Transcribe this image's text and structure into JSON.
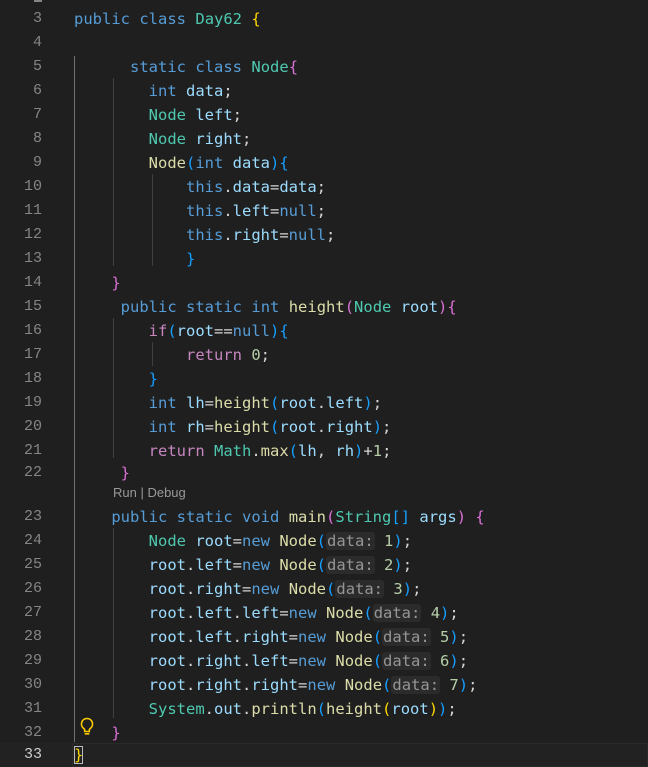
{
  "editor": {
    "lines": [
      {
        "num": "3",
        "tokens": [
          [
            "kw",
            "public"
          ],
          [
            "p",
            " "
          ],
          [
            "kw",
            "class"
          ],
          [
            "p",
            " "
          ],
          [
            "ty",
            "Day62"
          ],
          [
            "p",
            " "
          ],
          [
            "b1",
            "{"
          ]
        ]
      },
      {
        "num": "4",
        "tokens": []
      },
      {
        "num": "5",
        "tokens": [
          [
            "p",
            "      "
          ],
          [
            "kw",
            "static"
          ],
          [
            "p",
            " "
          ],
          [
            "kw",
            "class"
          ],
          [
            "p",
            " "
          ],
          [
            "ty",
            "Node"
          ],
          [
            "b2",
            "{"
          ]
        ]
      },
      {
        "num": "6",
        "tokens": [
          [
            "p",
            "        "
          ],
          [
            "kw",
            "int"
          ],
          [
            "p",
            " "
          ],
          [
            "va",
            "data"
          ],
          [
            "p",
            ";"
          ]
        ]
      },
      {
        "num": "7",
        "tokens": [
          [
            "p",
            "        "
          ],
          [
            "ty",
            "Node"
          ],
          [
            "p",
            " "
          ],
          [
            "va",
            "left"
          ],
          [
            "p",
            ";"
          ]
        ]
      },
      {
        "num": "8",
        "tokens": [
          [
            "p",
            "        "
          ],
          [
            "ty",
            "Node"
          ],
          [
            "p",
            " "
          ],
          [
            "va",
            "right"
          ],
          [
            "p",
            ";"
          ]
        ]
      },
      {
        "num": "9",
        "tokens": [
          [
            "p",
            "        "
          ],
          [
            "fn",
            "Node"
          ],
          [
            "b3",
            "("
          ],
          [
            "kw",
            "int"
          ],
          [
            "p",
            " "
          ],
          [
            "va",
            "data"
          ],
          [
            "b3",
            ")"
          ],
          [
            "b3",
            "{"
          ]
        ]
      },
      {
        "num": "10",
        "tokens": [
          [
            "p",
            "            "
          ],
          [
            "kw",
            "this"
          ],
          [
            "p",
            "."
          ],
          [
            "va",
            "data"
          ],
          [
            "p",
            "="
          ],
          [
            "va",
            "data"
          ],
          [
            "p",
            ";"
          ]
        ]
      },
      {
        "num": "11",
        "tokens": [
          [
            "p",
            "            "
          ],
          [
            "kw",
            "this"
          ],
          [
            "p",
            "."
          ],
          [
            "va",
            "left"
          ],
          [
            "p",
            "="
          ],
          [
            "kw",
            "null"
          ],
          [
            "p",
            ";"
          ]
        ]
      },
      {
        "num": "12",
        "tokens": [
          [
            "p",
            "            "
          ],
          [
            "kw",
            "this"
          ],
          [
            "p",
            "."
          ],
          [
            "va",
            "right"
          ],
          [
            "p",
            "="
          ],
          [
            "kw",
            "null"
          ],
          [
            "p",
            ";"
          ]
        ]
      },
      {
        "num": "13",
        "tokens": [
          [
            "p",
            "            "
          ],
          [
            "b3",
            "}"
          ]
        ]
      },
      {
        "num": "14",
        "tokens": [
          [
            "p",
            "    "
          ],
          [
            "b2",
            "}"
          ]
        ]
      },
      {
        "num": "15",
        "tokens": [
          [
            "p",
            "     "
          ],
          [
            "kw",
            "public"
          ],
          [
            "p",
            " "
          ],
          [
            "kw",
            "static"
          ],
          [
            "p",
            " "
          ],
          [
            "kw",
            "int"
          ],
          [
            "p",
            " "
          ],
          [
            "fn",
            "height"
          ],
          [
            "b2",
            "("
          ],
          [
            "ty",
            "Node"
          ],
          [
            "p",
            " "
          ],
          [
            "va",
            "root"
          ],
          [
            "b2",
            ")"
          ],
          [
            "b2",
            "{"
          ]
        ]
      },
      {
        "num": "16",
        "tokens": [
          [
            "p",
            "        "
          ],
          [
            "ctl",
            "if"
          ],
          [
            "b3",
            "("
          ],
          [
            "va",
            "root"
          ],
          [
            "p",
            "=="
          ],
          [
            "kw",
            "null"
          ],
          [
            "b3",
            ")"
          ],
          [
            "b3",
            "{"
          ]
        ]
      },
      {
        "num": "17",
        "tokens": [
          [
            "p",
            "            "
          ],
          [
            "ctl",
            "return"
          ],
          [
            "p",
            " "
          ],
          [
            "nu",
            "0"
          ],
          [
            "p",
            ";"
          ]
        ]
      },
      {
        "num": "18",
        "tokens": [
          [
            "p",
            "        "
          ],
          [
            "b3",
            "}"
          ]
        ]
      },
      {
        "num": "19",
        "tokens": [
          [
            "p",
            "        "
          ],
          [
            "kw",
            "int"
          ],
          [
            "p",
            " "
          ],
          [
            "va",
            "lh"
          ],
          [
            "p",
            "="
          ],
          [
            "fn",
            "height"
          ],
          [
            "b3",
            "("
          ],
          [
            "va",
            "root"
          ],
          [
            "p",
            "."
          ],
          [
            "va",
            "left"
          ],
          [
            "b3",
            ")"
          ],
          [
            "p",
            ";"
          ]
        ]
      },
      {
        "num": "20",
        "tokens": [
          [
            "p",
            "        "
          ],
          [
            "kw",
            "int"
          ],
          [
            "p",
            " "
          ],
          [
            "va",
            "rh"
          ],
          [
            "p",
            "="
          ],
          [
            "fn",
            "height"
          ],
          [
            "b3",
            "("
          ],
          [
            "va",
            "root"
          ],
          [
            "p",
            "."
          ],
          [
            "va",
            "right"
          ],
          [
            "b3",
            ")"
          ],
          [
            "p",
            ";"
          ]
        ]
      },
      {
        "num": "21",
        "tokens": [
          [
            "p",
            "        "
          ],
          [
            "ctl",
            "return"
          ],
          [
            "p",
            " "
          ],
          [
            "ty",
            "Math"
          ],
          [
            "p",
            "."
          ],
          [
            "fn",
            "max"
          ],
          [
            "b3",
            "("
          ],
          [
            "va",
            "lh"
          ],
          [
            "p",
            ", "
          ],
          [
            "va",
            "rh"
          ],
          [
            "b3",
            ")"
          ],
          [
            "p",
            "+"
          ],
          [
            "nu",
            "1"
          ],
          [
            "p",
            ";"
          ]
        ]
      },
      {
        "num": "22",
        "tokens": [
          [
            "p",
            "     "
          ],
          [
            "b2",
            "}"
          ]
        ]
      },
      {
        "num": "23",
        "tokens": [
          [
            "p",
            "    "
          ],
          [
            "kw",
            "public"
          ],
          [
            "p",
            " "
          ],
          [
            "kw",
            "static"
          ],
          [
            "p",
            " "
          ],
          [
            "kw",
            "void"
          ],
          [
            "p",
            " "
          ],
          [
            "fn",
            "main"
          ],
          [
            "b2",
            "("
          ],
          [
            "ty",
            "String"
          ],
          [
            "b3",
            "[]"
          ],
          [
            "p",
            " "
          ],
          [
            "va",
            "args"
          ],
          [
            "b2",
            ")"
          ],
          [
            "p",
            " "
          ],
          [
            "b2",
            "{"
          ]
        ]
      },
      {
        "num": "24",
        "tokens": [
          [
            "p",
            "        "
          ],
          [
            "ty",
            "Node"
          ],
          [
            "p",
            " "
          ],
          [
            "va",
            "root"
          ],
          [
            "p",
            "="
          ],
          [
            "kw",
            "new"
          ],
          [
            "p",
            " "
          ],
          [
            "fn",
            "Node"
          ],
          [
            "b3",
            "("
          ],
          [
            "hint",
            "data:"
          ],
          [
            "p",
            " "
          ],
          [
            "nu",
            "1"
          ],
          [
            "b3",
            ")"
          ],
          [
            "p",
            ";"
          ]
        ]
      },
      {
        "num": "25",
        "tokens": [
          [
            "p",
            "        "
          ],
          [
            "va",
            "root"
          ],
          [
            "p",
            "."
          ],
          [
            "va",
            "left"
          ],
          [
            "p",
            "="
          ],
          [
            "kw",
            "new"
          ],
          [
            "p",
            " "
          ],
          [
            "fn",
            "Node"
          ],
          [
            "b3",
            "("
          ],
          [
            "hint",
            "data:"
          ],
          [
            "p",
            " "
          ],
          [
            "nu",
            "2"
          ],
          [
            "b3",
            ")"
          ],
          [
            "p",
            ";"
          ]
        ]
      },
      {
        "num": "26",
        "tokens": [
          [
            "p",
            "        "
          ],
          [
            "va",
            "root"
          ],
          [
            "p",
            "."
          ],
          [
            "va",
            "right"
          ],
          [
            "p",
            "="
          ],
          [
            "kw",
            "new"
          ],
          [
            "p",
            " "
          ],
          [
            "fn",
            "Node"
          ],
          [
            "b3",
            "("
          ],
          [
            "hint",
            "data:"
          ],
          [
            "p",
            " "
          ],
          [
            "nu",
            "3"
          ],
          [
            "b3",
            ")"
          ],
          [
            "p",
            ";"
          ]
        ]
      },
      {
        "num": "27",
        "tokens": [
          [
            "p",
            "        "
          ],
          [
            "va",
            "root"
          ],
          [
            "p",
            "."
          ],
          [
            "va",
            "left"
          ],
          [
            "p",
            "."
          ],
          [
            "va",
            "left"
          ],
          [
            "p",
            "="
          ],
          [
            "kw",
            "new"
          ],
          [
            "p",
            " "
          ],
          [
            "fn",
            "Node"
          ],
          [
            "b3",
            "("
          ],
          [
            "hint",
            "data:"
          ],
          [
            "p",
            " "
          ],
          [
            "nu",
            "4"
          ],
          [
            "b3",
            ")"
          ],
          [
            "p",
            ";"
          ]
        ]
      },
      {
        "num": "28",
        "tokens": [
          [
            "p",
            "        "
          ],
          [
            "va",
            "root"
          ],
          [
            "p",
            "."
          ],
          [
            "va",
            "left"
          ],
          [
            "p",
            "."
          ],
          [
            "va",
            "right"
          ],
          [
            "p",
            "="
          ],
          [
            "kw",
            "new"
          ],
          [
            "p",
            " "
          ],
          [
            "fn",
            "Node"
          ],
          [
            "b3",
            "("
          ],
          [
            "hint",
            "data:"
          ],
          [
            "p",
            " "
          ],
          [
            "nu",
            "5"
          ],
          [
            "b3",
            ")"
          ],
          [
            "p",
            ";"
          ]
        ]
      },
      {
        "num": "29",
        "tokens": [
          [
            "p",
            "        "
          ],
          [
            "va",
            "root"
          ],
          [
            "p",
            "."
          ],
          [
            "va",
            "right"
          ],
          [
            "p",
            "."
          ],
          [
            "va",
            "left"
          ],
          [
            "p",
            "="
          ],
          [
            "kw",
            "new"
          ],
          [
            "p",
            " "
          ],
          [
            "fn",
            "Node"
          ],
          [
            "b3",
            "("
          ],
          [
            "hint",
            "data:"
          ],
          [
            "p",
            " "
          ],
          [
            "nu",
            "6"
          ],
          [
            "b3",
            ")"
          ],
          [
            "p",
            ";"
          ]
        ]
      },
      {
        "num": "30",
        "tokens": [
          [
            "p",
            "        "
          ],
          [
            "va",
            "root"
          ],
          [
            "p",
            "."
          ],
          [
            "va",
            "right"
          ],
          [
            "p",
            "."
          ],
          [
            "va",
            "right"
          ],
          [
            "p",
            "="
          ],
          [
            "kw",
            "new"
          ],
          [
            "p",
            " "
          ],
          [
            "fn",
            "Node"
          ],
          [
            "b3",
            "("
          ],
          [
            "hint",
            "data:"
          ],
          [
            "p",
            " "
          ],
          [
            "nu",
            "7"
          ],
          [
            "b3",
            ")"
          ],
          [
            "p",
            ";"
          ]
        ]
      },
      {
        "num": "31",
        "tokens": [
          [
            "p",
            "        "
          ],
          [
            "ty",
            "System"
          ],
          [
            "p",
            "."
          ],
          [
            "va",
            "out"
          ],
          [
            "p",
            "."
          ],
          [
            "fn",
            "println"
          ],
          [
            "b3",
            "("
          ],
          [
            "fn",
            "height"
          ],
          [
            "b1",
            "("
          ],
          [
            "va",
            "root"
          ],
          [
            "b1",
            ")"
          ],
          [
            "b3",
            ")"
          ],
          [
            "p",
            ";"
          ]
        ]
      },
      {
        "num": "32",
        "tokens": [
          [
            "p",
            "    "
          ],
          [
            "b2",
            "}"
          ]
        ]
      },
      {
        "num": "33",
        "tokens": [
          [
            "b1",
            "}"
          ]
        ]
      }
    ],
    "codelens": "Run | Debug",
    "active_line": "33",
    "bulb_icon": "lightbulb-icon"
  }
}
